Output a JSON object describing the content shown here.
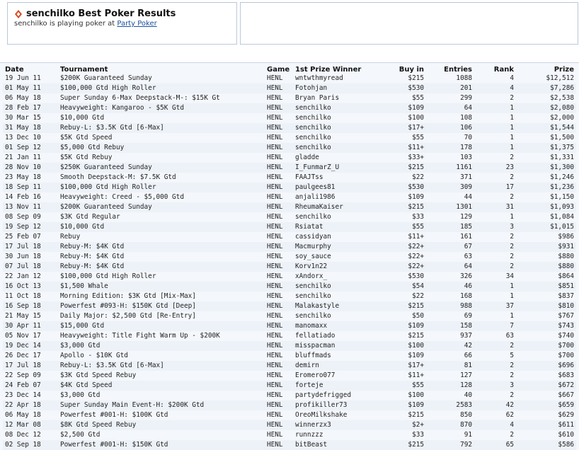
{
  "header": {
    "title": "senchilko Best Poker Results",
    "subtitle_prefix": "senchilko is playing poker at",
    "site_link": "Party Poker"
  },
  "table": {
    "columns": [
      "Date",
      "Tournament",
      "Game",
      "1st Prize Winner",
      "Buy in",
      "Entries",
      "Rank",
      "Prize"
    ],
    "rows": [
      [
        "19 Jun 11",
        "$200K Guaranteed Sunday",
        "HENL",
        "wntwthmyread",
        "$215",
        "1088",
        "4",
        "$12,512"
      ],
      [
        "01 May 11",
        "$100,000 Gtd High Roller",
        "HENL",
        "Fotohjan",
        "$530",
        "201",
        "4",
        "$7,286"
      ],
      [
        "06 May 18",
        "Super Sunday 6-Max Deepstack-M-: $15K Gt",
        "HENL",
        "Bryan Paris",
        "$55",
        "299",
        "2",
        "$2,538"
      ],
      [
        "28 Feb 17",
        "Heavyweight: Kangaroo - $5K Gtd",
        "HENL",
        "senchilko",
        "$109",
        "64",
        "1",
        "$2,080"
      ],
      [
        "30 Mar 15",
        "$10,000 Gtd",
        "HENL",
        "senchilko",
        "$100",
        "108",
        "1",
        "$2,000"
      ],
      [
        "31 May 18",
        "Rebuy-L: $3.5K Gtd [6-Max]",
        "HENL",
        "senchilko",
        "$17+",
        "106",
        "1",
        "$1,544"
      ],
      [
        "13 Dec 10",
        "$5K Gtd Speed",
        "HENL",
        "senchilko",
        "$55",
        "70",
        "1",
        "$1,500"
      ],
      [
        "01 Sep 12",
        "$5,000 Gtd Rebuy",
        "HENL",
        "senchilko",
        "$11+",
        "178",
        "1",
        "$1,375"
      ],
      [
        "21 Jan 11",
        "$5K Gtd Rebuy",
        "HENL",
        "gladde",
        "$33+",
        "103",
        "2",
        "$1,331"
      ],
      [
        "28 Nov 10",
        "$250K Guaranteed Sunday",
        "HENL",
        "I_FunmarZ_U",
        "$215",
        "1161",
        "23",
        "$1,300"
      ],
      [
        "23 May 18",
        "Smooth Deepstack-M: $7.5K Gtd",
        "HENL",
        "FAAJTss",
        "$22",
        "371",
        "2",
        "$1,246"
      ],
      [
        "18 Sep 11",
        "$100,000 Gtd High Roller",
        "HENL",
        "paulgees81",
        "$530",
        "309",
        "17",
        "$1,236"
      ],
      [
        "14 Feb 16",
        "Heavyweight: Creed - $5,000 Gtd",
        "HENL",
        "anjali1986",
        "$109",
        "44",
        "2",
        "$1,150"
      ],
      [
        "13 Nov 11",
        "$200K Guaranteed Sunday",
        "HENL",
        "RheumaKaiser",
        "$215",
        "1301",
        "31",
        "$1,093"
      ],
      [
        "08 Sep 09",
        "$3K Gtd Regular",
        "HENL",
        "senchilko",
        "$33",
        "129",
        "1",
        "$1,084"
      ],
      [
        "19 Sep 12",
        "$10,000 Gtd",
        "HENL",
        "Rsiatat",
        "$55",
        "185",
        "3",
        "$1,015"
      ],
      [
        "25 Feb 07",
        "Rebuy",
        "HENL",
        "cassidyan",
        "$11+",
        "161",
        "2",
        "$986"
      ],
      [
        "17 Jul 18",
        "Rebuy-M: $4K Gtd",
        "HENL",
        "Macmurphy",
        "$22+",
        "67",
        "2",
        "$931"
      ],
      [
        "30 Jun 18",
        "Rebuy-M: $4K Gtd",
        "HENL",
        "soy_sauce",
        "$22+",
        "63",
        "2",
        "$880"
      ],
      [
        "07 Jul 18",
        "Rebuy-M: $4K Gtd",
        "HENL",
        "Korv1n22",
        "$22+",
        "64",
        "2",
        "$880"
      ],
      [
        "22 Jan 12",
        "$100,000 Gtd High Roller",
        "HENL",
        "xAndorx_",
        "$530",
        "326",
        "34",
        "$864"
      ],
      [
        "16 Oct 13",
        "$1,500 Whale",
        "HENL",
        "senchilko",
        "$54",
        "46",
        "1",
        "$851"
      ],
      [
        "11 Oct 18",
        "Morning Edition: $3K Gtd [Mix-Max]",
        "HENL",
        "senchilko",
        "$22",
        "168",
        "1",
        "$837"
      ],
      [
        "16 Sep 18",
        "Powerfest #093-H: $150K Gtd [Deep]",
        "HENL",
        "Malakastyle",
        "$215",
        "988",
        "37",
        "$810"
      ],
      [
        "21 May 15",
        "Daily Major: $2,500 Gtd [Re-Entry]",
        "HENL",
        "senchilko",
        "$50",
        "69",
        "1",
        "$767"
      ],
      [
        "30 Apr 11",
        "$15,000 Gtd",
        "HENL",
        "manomaxx",
        "$109",
        "158",
        "7",
        "$743"
      ],
      [
        "05 Nov 17",
        "Heavyweight: Title Fight Warm Up - $200K",
        "HENL",
        "fellatiado",
        "$215",
        "937",
        "63",
        "$740"
      ],
      [
        "19 Dec 14",
        "$3,000 Gtd",
        "HENL",
        "misspacman",
        "$100",
        "42",
        "2",
        "$700"
      ],
      [
        "26 Dec 17",
        "Apollo - $10K Gtd",
        "HENL",
        "bluffmads",
        "$109",
        "66",
        "5",
        "$700"
      ],
      [
        "17 Jul 18",
        "Rebuy-L: $3.5K Gtd [6-Max]",
        "HENL",
        "demirn",
        "$17+",
        "81",
        "2",
        "$696"
      ],
      [
        "22 Sep 09",
        "$3K Gtd Speed Rebuy",
        "HENL",
        "Eromero077",
        "$11+",
        "127",
        "2",
        "$683"
      ],
      [
        "24 Feb 07",
        "$4K Gtd Speed",
        "HENL",
        "forteje",
        "$55",
        "128",
        "3",
        "$672"
      ],
      [
        "23 Dec 14",
        "$3,000 Gtd",
        "HENL",
        "partydefrigged",
        "$100",
        "40",
        "2",
        "$667"
      ],
      [
        "22 Apr 18",
        "Super Sunday Main Event-H: $200K Gtd",
        "HENL",
        "profikiller73",
        "$109",
        "2583",
        "42",
        "$659"
      ],
      [
        "06 May 18",
        "Powerfest #001-H: $100K Gtd",
        "HENL",
        "OreoMilkshake",
        "$215",
        "850",
        "62",
        "$629"
      ],
      [
        "12 Mar 08",
        "$8K Gtd Speed Rebuy",
        "HENL",
        "winnerzx3",
        "$2+",
        "870",
        "4",
        "$611"
      ],
      [
        "08 Dec 12",
        "$2,500 Gtd",
        "HENL",
        "runnzzz",
        "$33",
        "91",
        "2",
        "$610"
      ],
      [
        "02 Sep 18",
        "Powerfest #001-H: $150K Gtd",
        "HENL",
        "bitBeast",
        "$215",
        "792",
        "65",
        "$586"
      ]
    ]
  },
  "colors": {
    "accent_diamond": "#d9471c",
    "link": "#1b4fa0"
  }
}
